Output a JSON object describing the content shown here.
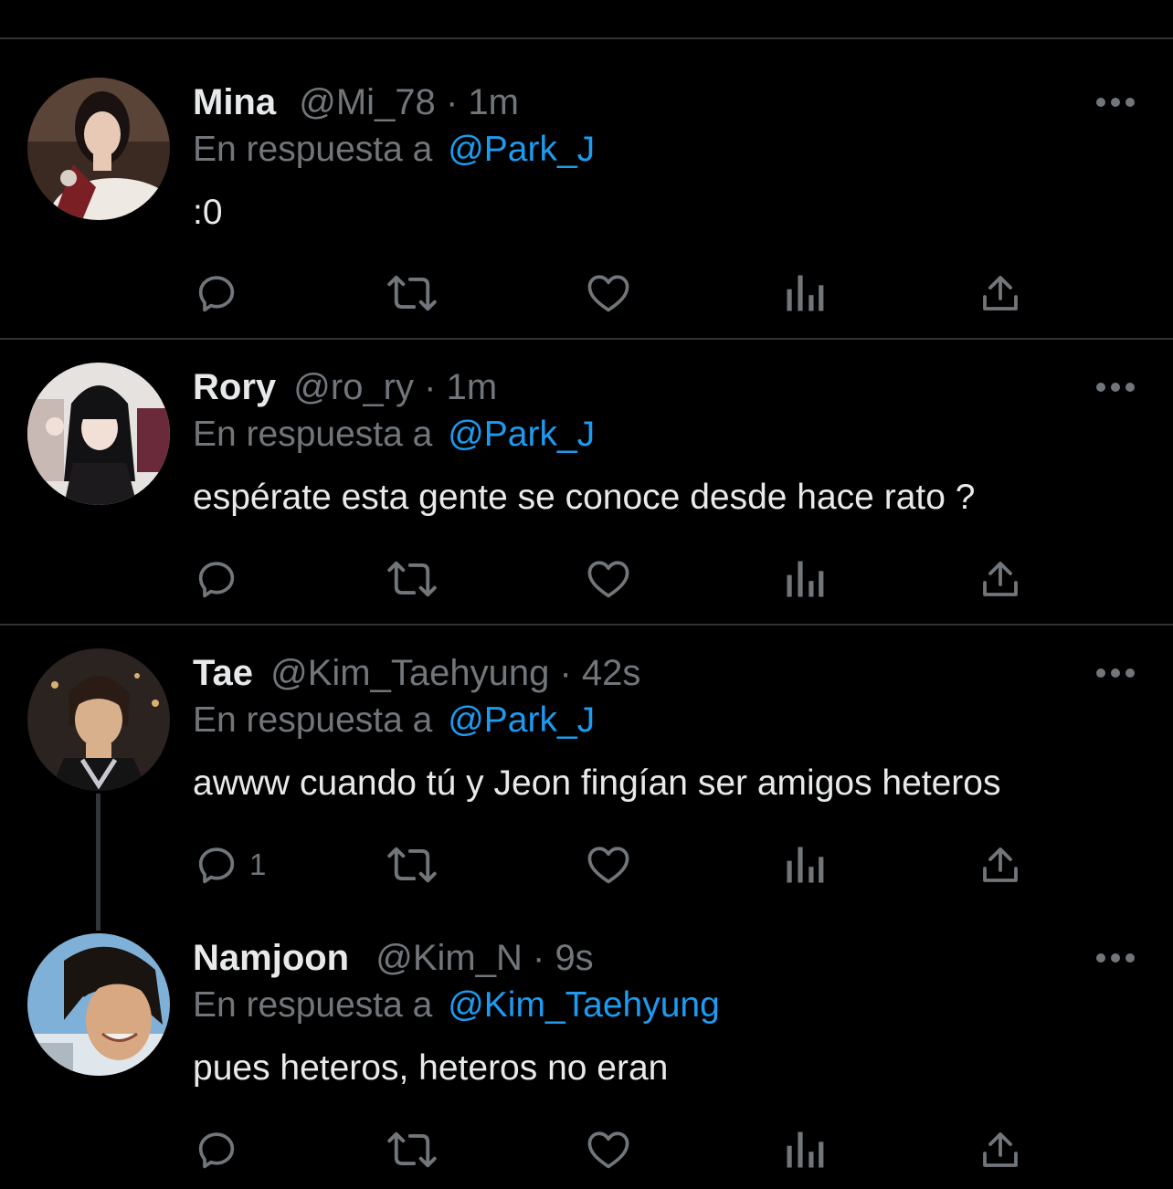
{
  "tweets": [
    {
      "name": "Mina",
      "handle": "@Mi_78",
      "separator": "·",
      "time": "1m",
      "reply_prefix": "En respuesta a",
      "reply_to": "@Park_J",
      "text": ":0",
      "reply_count": ""
    },
    {
      "name": "Rory",
      "handle": "@ro_ry",
      "separator": "·",
      "time": "1m",
      "reply_prefix": "En respuesta a",
      "reply_to": "@Park_J",
      "text": "espérate esta gente se conoce desde hace rato ?",
      "reply_count": ""
    },
    {
      "name": "Tae",
      "handle": "@Kim_Taehyung",
      "separator": "·",
      "time": "42s",
      "reply_prefix": "En respuesta a",
      "reply_to": "@Park_J",
      "text": "awww cuando tú y Jeon fingían ser amigos heteros",
      "reply_count": "1"
    },
    {
      "name": "Namjoon",
      "handle": "@Kim_N",
      "separator": "·",
      "time": "9s",
      "reply_prefix": "En respuesta a",
      "reply_to": "@Kim_Taehyung",
      "text": "pues heteros, heteros no eran",
      "reply_count": ""
    }
  ],
  "icons": {
    "more": "more-dots-icon",
    "reply": "reply-bubble-icon",
    "retweet": "retweet-arrows-icon",
    "like": "heart-icon",
    "views": "analytics-bars-icon",
    "share": "share-upload-icon"
  },
  "colors": {
    "background": "#000000",
    "primary_text": "#e7e9ea",
    "secondary_text": "#71767b",
    "accent": "#1d9bf0",
    "divider": "#2f3336",
    "thread_line": "#333639"
  }
}
